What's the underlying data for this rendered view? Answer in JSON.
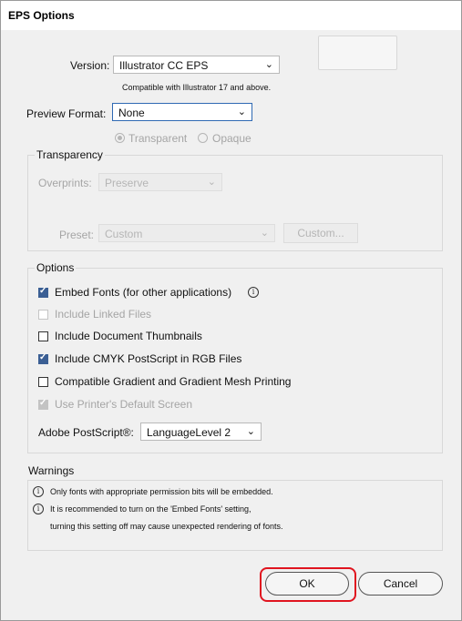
{
  "window": {
    "title": "EPS Options"
  },
  "version": {
    "label": "Version:",
    "selected": "Illustrator CC EPS",
    "note": "Compatible with Illustrator 17 and above."
  },
  "preview": {
    "label": "Preview Format:",
    "selected": "None",
    "radio_transparent": "Transparent",
    "radio_opaque": "Opaque"
  },
  "transparency": {
    "title": "Transparency",
    "overprints_label": "Overprints:",
    "overprints_value": "Preserve",
    "preset_label": "Preset:",
    "preset_value": "Custom",
    "custom_button": "Custom..."
  },
  "options": {
    "title": "Options",
    "embed_fonts": "Embed Fonts (for other applications)",
    "include_linked": "Include Linked Files",
    "include_thumbnails": "Include Document Thumbnails",
    "include_cmyk": "Include CMYK PostScript in RGB Files",
    "compatible_gradient": "Compatible Gradient and Gradient Mesh Printing",
    "use_printer_screen": "Use Printer's Default Screen",
    "postscript_label": "Adobe PostScript®:",
    "postscript_value": "LanguageLevel 2"
  },
  "warnings": {
    "title": "Warnings",
    "line1": "Only fonts with appropriate permission bits will be embedded.",
    "line2": "It is recommended to turn on the 'Embed Fonts' setting,",
    "line3": "turning this setting off may cause unexpected rendering of fonts."
  },
  "buttons": {
    "ok": "OK",
    "cancel": "Cancel"
  },
  "icons": {
    "info": "i",
    "chevron": "⌄"
  }
}
